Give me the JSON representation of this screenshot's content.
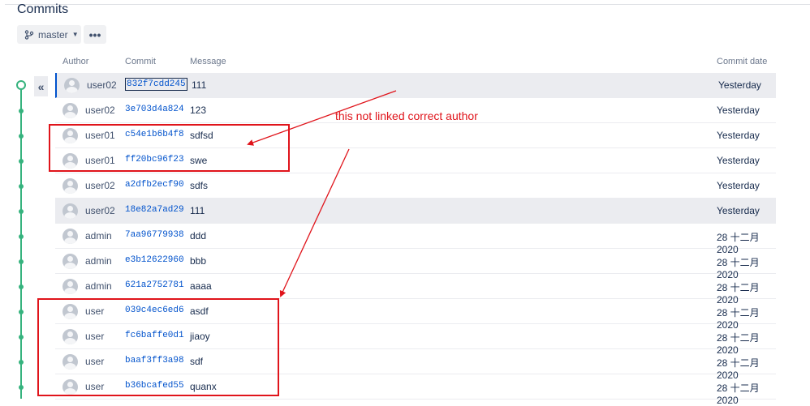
{
  "page": {
    "title": "Commits"
  },
  "toolbar": {
    "branch_label": "master",
    "more_label": "•••"
  },
  "columns": {
    "author": "Author",
    "commit": "Commit",
    "message": "Message",
    "date": "Commit date"
  },
  "collapse_label": "«",
  "commits": [
    {
      "author": "user02",
      "hash": "832f7cdd245",
      "message": "111",
      "date": "Yesterday"
    },
    {
      "author": "user02",
      "hash": "3e703d4a824",
      "message": "123",
      "date": "Yesterday"
    },
    {
      "author": "user01",
      "hash": "c54e1b6b4f8",
      "message": "sdfsd",
      "date": "Yesterday"
    },
    {
      "author": "user01",
      "hash": "ff20bc96f23",
      "message": "swe",
      "date": "Yesterday"
    },
    {
      "author": "user02",
      "hash": "a2dfb2ecf90",
      "message": "sdfs",
      "date": "Yesterday"
    },
    {
      "author": "user02",
      "hash": "18e82a7ad29",
      "message": "111",
      "date": "Yesterday"
    },
    {
      "author": "admin",
      "hash": "7aa96779938",
      "message": "ddd",
      "date": "28 十二月 2020"
    },
    {
      "author": "admin",
      "hash": "e3b12622960",
      "message": "bbb",
      "date": "28 十二月 2020"
    },
    {
      "author": "admin",
      "hash": "621a2752781",
      "message": "aaaa",
      "date": "28 十二月 2020"
    },
    {
      "author": "user",
      "hash": "039c4ec6ed6",
      "message": "asdf",
      "date": "28 十二月 2020"
    },
    {
      "author": "user",
      "hash": "fc6baffe0d1",
      "message": "jiaoy",
      "date": "28 十二月 2020"
    },
    {
      "author": "user",
      "hash": "baaf3ff3a98",
      "message": "sdf",
      "date": "28 十二月 2020"
    },
    {
      "author": "user",
      "hash": "b36bcafed55",
      "message": "quanx",
      "date": "28 十二月 2020"
    }
  ],
  "annotation": {
    "text": "this not linked correct author",
    "color": "#e0141b"
  },
  "colors": {
    "graph": "#36b37e",
    "link": "#0052cc",
    "row_highlight": "#ebecf0"
  }
}
